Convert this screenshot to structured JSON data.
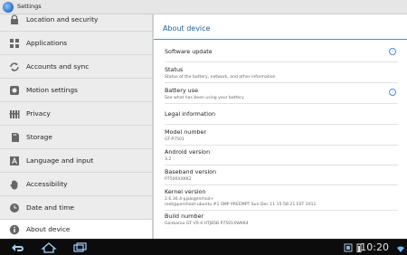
{
  "titlebar": {
    "title": "Settings"
  },
  "sidebar": {
    "items": [
      {
        "label": "Location and security",
        "icon": "lock-icon"
      },
      {
        "label": "Applications",
        "icon": "apps-icon"
      },
      {
        "label": "Accounts and sync",
        "icon": "sync-icon"
      },
      {
        "label": "Motion settings",
        "icon": "motion-icon"
      },
      {
        "label": "Privacy",
        "icon": "privacy-icon"
      },
      {
        "label": "Storage",
        "icon": "storage-icon"
      },
      {
        "label": "Language and input",
        "icon": "language-icon"
      },
      {
        "label": "Accessibility",
        "icon": "hand-icon"
      },
      {
        "label": "Date and time",
        "icon": "clock-icon"
      },
      {
        "label": "About device",
        "icon": "info-icon",
        "selected": true
      }
    ]
  },
  "main": {
    "header": "About device",
    "prefs": {
      "software_update": {
        "title": "Software update"
      },
      "status": {
        "title": "Status",
        "summary": "Status of the battery, network, and other information"
      },
      "battery_use": {
        "title": "Battery use",
        "summary": "See what has been using your battery"
      },
      "legal": {
        "title": "Legal information"
      },
      "model": {
        "title": "Model number",
        "summary": "GT-P7501"
      },
      "android": {
        "title": "Android version",
        "summary": "3.2"
      },
      "baseband": {
        "title": "Baseband version",
        "summary": "P7500XXKK2"
      },
      "kernel": {
        "title": "Kernel version",
        "summary1": "2.6.36.4-pjalogenmod+",
        "summary2": "root@pershoot-ubuntu #1 SMP PREEMPT Sun Dec 11 15:58:21 EST 2011"
      },
      "build": {
        "title": "Build number",
        "summary": "Ganbarou GT V0.4 HTJ85B P7501XWKK4"
      }
    }
  },
  "sysbar": {
    "clock": "10:20"
  },
  "colors": {
    "accent": "#4a90cf",
    "header_text": "#1c5f9c",
    "sidebar_bg": "#ececec",
    "sysbar_bg": "#0c0c0c"
  }
}
